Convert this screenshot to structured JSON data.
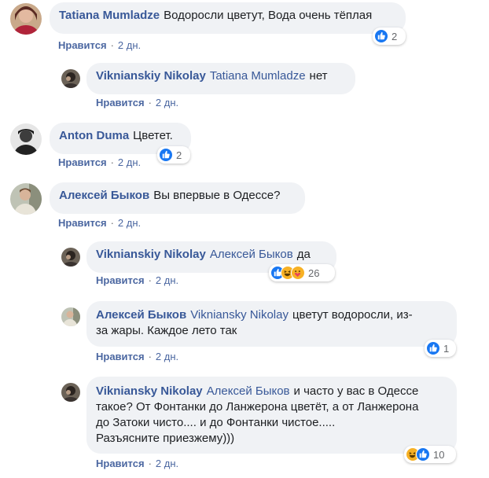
{
  "comments": [
    {
      "author": "Tatiana Mumladze",
      "mention": "",
      "text": "Водоросли цветут, Вода очень тёплая",
      "like": "Нравится",
      "time": "2 дн.",
      "reactions": "2"
    },
    {
      "author": "Viknianskiy Nikolay",
      "mention": "Tatiana Mumladze",
      "text": "нет",
      "like": "Нравится",
      "time": "2 дн.",
      "reactions": ""
    },
    {
      "author": "Anton Duma",
      "mention": "",
      "text": "Цветет.",
      "like": "Нравится",
      "time": "2 дн.",
      "reactions": "2"
    },
    {
      "author": "Алексей Быков",
      "mention": "",
      "text": "Вы впервые в Одессе?",
      "like": "Нравится",
      "time": "2 дн.",
      "reactions": ""
    },
    {
      "author": "Viknianskiy Nikolay",
      "mention": "Алексей Быков",
      "text": "да",
      "like": "Нравится",
      "time": "2 дн.",
      "reactions": "26"
    },
    {
      "author": "Алексей Быков",
      "mention": "Vikniansky Nikolay",
      "text_line1": "цветут водоросли, из-",
      "text_line2": "за жары. Каждое лето так",
      "like": "Нравится",
      "time": "2 дн.",
      "reactions": "1"
    },
    {
      "author": "Vikniansky Nikolay",
      "mention": "Алексей Быков",
      "text_line1": "и часто у вас в Одессе",
      "text_line2": "такое? От Фонтанки до Ланжерона цветёт, а от Ланжерона",
      "text_line3": "до Затоки чисто.... и до Фонтанки чистое.....",
      "text_line4": "Разъясните приезжему)))",
      "like": "Нравится",
      "time": "2 дн.",
      "reactions": "10"
    }
  ],
  "colors": {
    "link": "#385898",
    "bubble": "#f0f2f5",
    "like_blue": "#1877f2",
    "haha_yellow": "#f7b125"
  }
}
